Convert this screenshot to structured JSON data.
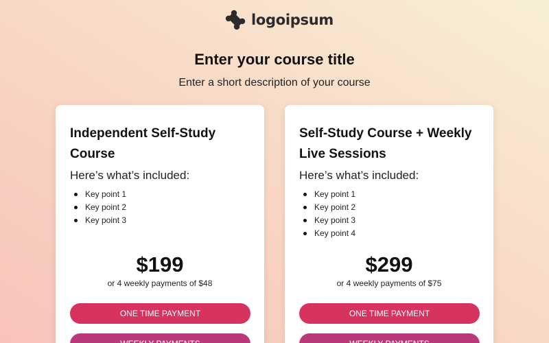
{
  "brand": {
    "logo_text": "logoipsum",
    "icon": "logo-mark-icon"
  },
  "header": {
    "title": "Enter your course title",
    "subtitle": "Enter a short description of your course"
  },
  "colors": {
    "one_time_button": "#d6345f",
    "weekly_button": "#b83a78",
    "background_start": "#f8c3bb",
    "background_end": "#f8efd6"
  },
  "cards": [
    {
      "title": "Independent Self-Study Course",
      "included_label": "Here’s what’s included:",
      "points": [
        "Key point 1",
        "Key point 2",
        "Key point 3"
      ],
      "price": "$199",
      "installments": "or 4 weekly payments of $48",
      "one_time_label": "ONE TIME PAYMENT",
      "weekly_label": "WEEKLY PAYMENTS"
    },
    {
      "title": "Self-Study Course + Weekly Live Sessions",
      "included_label": "Here’s what’s included:",
      "points": [
        "Key point 1",
        "Key point 2",
        "Key point 3",
        "Key point 4"
      ],
      "price": "$299",
      "installments": "or 4 weekly payments of $75",
      "one_time_label": "ONE TIME PAYMENT",
      "weekly_label": "WEEKLY PAYMENTS"
    }
  ]
}
